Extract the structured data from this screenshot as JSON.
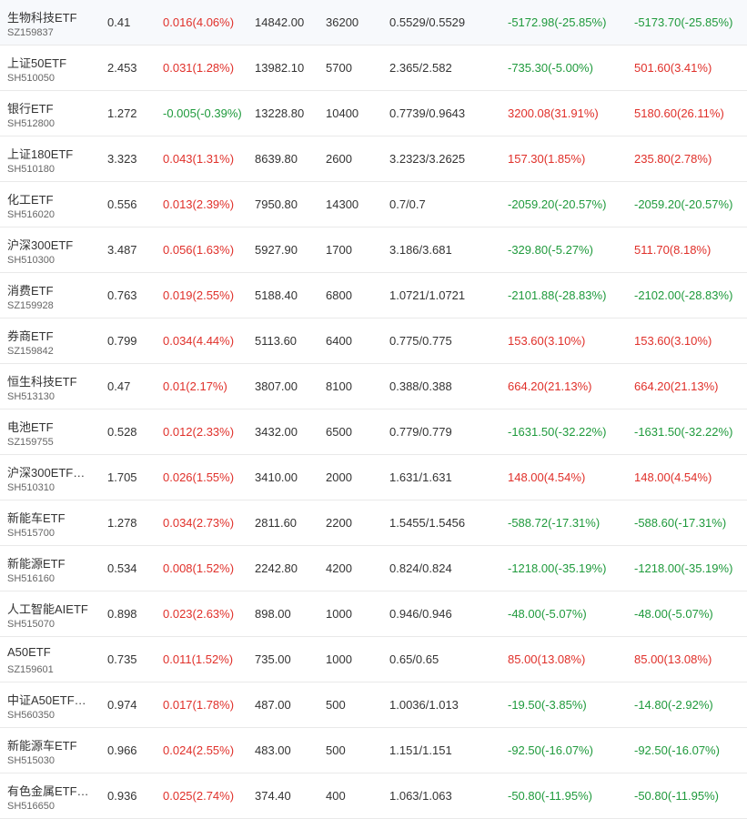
{
  "colors": {
    "up": "#e0302a",
    "down": "#1f9a3c"
  },
  "rows": [
    {
      "name": "生物科技ETF",
      "code": "SZ159837",
      "price": "0.41",
      "change": "0.016(4.06%)",
      "change_dir": "up",
      "market_value": "14842.00",
      "quantity": "36200",
      "cost": "0.5529/0.5529",
      "pl1": "-5172.98(-25.85%)",
      "pl1_dir": "down",
      "pl2": "-5173.70(-25.85%)",
      "pl2_dir": "down"
    },
    {
      "name": "上证50ETF",
      "code": "SH510050",
      "price": "2.453",
      "change": "0.031(1.28%)",
      "change_dir": "up",
      "market_value": "13982.10",
      "quantity": "5700",
      "cost": "2.365/2.582",
      "pl1": "-735.30(-5.00%)",
      "pl1_dir": "down",
      "pl2": "501.60(3.41%)",
      "pl2_dir": "up"
    },
    {
      "name": "银行ETF",
      "code": "SH512800",
      "price": "1.272",
      "change": "-0.005(-0.39%)",
      "change_dir": "down",
      "market_value": "13228.80",
      "quantity": "10400",
      "cost": "0.7739/0.9643",
      "pl1": "3200.08(31.91%)",
      "pl1_dir": "up",
      "pl2": "5180.60(26.11%)",
      "pl2_dir": "up"
    },
    {
      "name": "上证180ETF",
      "code": "SH510180",
      "price": "3.323",
      "change": "0.043(1.31%)",
      "change_dir": "up",
      "market_value": "8639.80",
      "quantity": "2600",
      "cost": "3.2323/3.2625",
      "pl1": "157.30(1.85%)",
      "pl1_dir": "up",
      "pl2": "235.80(2.78%)",
      "pl2_dir": "up"
    },
    {
      "name": "化工ETF",
      "code": "SH516020",
      "price": "0.556",
      "change": "0.013(2.39%)",
      "change_dir": "up",
      "market_value": "7950.80",
      "quantity": "14300",
      "cost": "0.7/0.7",
      "pl1": "-2059.20(-20.57%)",
      "pl1_dir": "down",
      "pl2": "-2059.20(-20.57%)",
      "pl2_dir": "down"
    },
    {
      "name": "沪深300ETF",
      "code": "SH510300",
      "price": "3.487",
      "change": "0.056(1.63%)",
      "change_dir": "up",
      "market_value": "5927.90",
      "quantity": "1700",
      "cost": "3.186/3.681",
      "pl1": "-329.80(-5.27%)",
      "pl1_dir": "down",
      "pl2": "511.70(8.18%)",
      "pl2_dir": "up"
    },
    {
      "name": "消费ETF",
      "code": "SZ159928",
      "price": "0.763",
      "change": "0.019(2.55%)",
      "change_dir": "up",
      "market_value": "5188.40",
      "quantity": "6800",
      "cost": "1.0721/1.0721",
      "pl1": "-2101.88(-28.83%)",
      "pl1_dir": "down",
      "pl2": "-2102.00(-28.83%)",
      "pl2_dir": "down"
    },
    {
      "name": "券商ETF",
      "code": "SZ159842",
      "price": "0.799",
      "change": "0.034(4.44%)",
      "change_dir": "up",
      "market_value": "5113.60",
      "quantity": "6400",
      "cost": "0.775/0.775",
      "pl1": "153.60(3.10%)",
      "pl1_dir": "up",
      "pl2": "153.60(3.10%)",
      "pl2_dir": "up"
    },
    {
      "name": "恒生科技ETF",
      "code": "SH513130",
      "price": "0.47",
      "change": "0.01(2.17%)",
      "change_dir": "up",
      "market_value": "3807.00",
      "quantity": "8100",
      "cost": "0.388/0.388",
      "pl1": "664.20(21.13%)",
      "pl1_dir": "up",
      "pl2": "664.20(21.13%)",
      "pl2_dir": "up"
    },
    {
      "name": "电池ETF",
      "code": "SZ159755",
      "price": "0.528",
      "change": "0.012(2.33%)",
      "change_dir": "up",
      "market_value": "3432.00",
      "quantity": "6500",
      "cost": "0.779/0.779",
      "pl1": "-1631.50(-32.22%)",
      "pl1_dir": "down",
      "pl2": "-1631.50(-32.22%)",
      "pl2_dir": "down"
    },
    {
      "name": "沪深300ETF…",
      "code": "SH510310",
      "price": "1.705",
      "change": "0.026(1.55%)",
      "change_dir": "up",
      "market_value": "3410.00",
      "quantity": "2000",
      "cost": "1.631/1.631",
      "pl1": "148.00(4.54%)",
      "pl1_dir": "up",
      "pl2": "148.00(4.54%)",
      "pl2_dir": "up"
    },
    {
      "name": "新能车ETF",
      "code": "SH515700",
      "price": "1.278",
      "change": "0.034(2.73%)",
      "change_dir": "up",
      "market_value": "2811.60",
      "quantity": "2200",
      "cost": "1.5455/1.5456",
      "pl1": "-588.72(-17.31%)",
      "pl1_dir": "down",
      "pl2": "-588.60(-17.31%)",
      "pl2_dir": "down"
    },
    {
      "name": "新能源ETF",
      "code": "SH516160",
      "price": "0.534",
      "change": "0.008(1.52%)",
      "change_dir": "up",
      "market_value": "2242.80",
      "quantity": "4200",
      "cost": "0.824/0.824",
      "pl1": "-1218.00(-35.19%)",
      "pl1_dir": "down",
      "pl2": "-1218.00(-35.19%)",
      "pl2_dir": "down"
    },
    {
      "name": "人工智能AIETF",
      "code": "SH515070",
      "price": "0.898",
      "change": "0.023(2.63%)",
      "change_dir": "up",
      "market_value": "898.00",
      "quantity": "1000",
      "cost": "0.946/0.946",
      "pl1": "-48.00(-5.07%)",
      "pl1_dir": "down",
      "pl2": "-48.00(-5.07%)",
      "pl2_dir": "down"
    },
    {
      "name": "A50ETF",
      "code": "SZ159601",
      "price": "0.735",
      "change": "0.011(1.52%)",
      "change_dir": "up",
      "market_value": "735.00",
      "quantity": "1000",
      "cost": "0.65/0.65",
      "pl1": "85.00(13.08%)",
      "pl1_dir": "up",
      "pl2": "85.00(13.08%)",
      "pl2_dir": "up"
    },
    {
      "name": "中证A50ETF…",
      "code": "SH560350",
      "price": "0.974",
      "change": "0.017(1.78%)",
      "change_dir": "up",
      "market_value": "487.00",
      "quantity": "500",
      "cost": "1.0036/1.013",
      "pl1": "-19.50(-3.85%)",
      "pl1_dir": "down",
      "pl2": "-14.80(-2.92%)",
      "pl2_dir": "down"
    },
    {
      "name": "新能源车ETF",
      "code": "SH515030",
      "price": "0.966",
      "change": "0.024(2.55%)",
      "change_dir": "up",
      "market_value": "483.00",
      "quantity": "500",
      "cost": "1.151/1.151",
      "pl1": "-92.50(-16.07%)",
      "pl1_dir": "down",
      "pl2": "-92.50(-16.07%)",
      "pl2_dir": "down"
    },
    {
      "name": "有色金属ETF…",
      "code": "SH516650",
      "price": "0.936",
      "change": "0.025(2.74%)",
      "change_dir": "up",
      "market_value": "374.40",
      "quantity": "400",
      "cost": "1.063/1.063",
      "pl1": "-50.80(-11.95%)",
      "pl1_dir": "down",
      "pl2": "-50.80(-11.95%)",
      "pl2_dir": "down"
    }
  ]
}
